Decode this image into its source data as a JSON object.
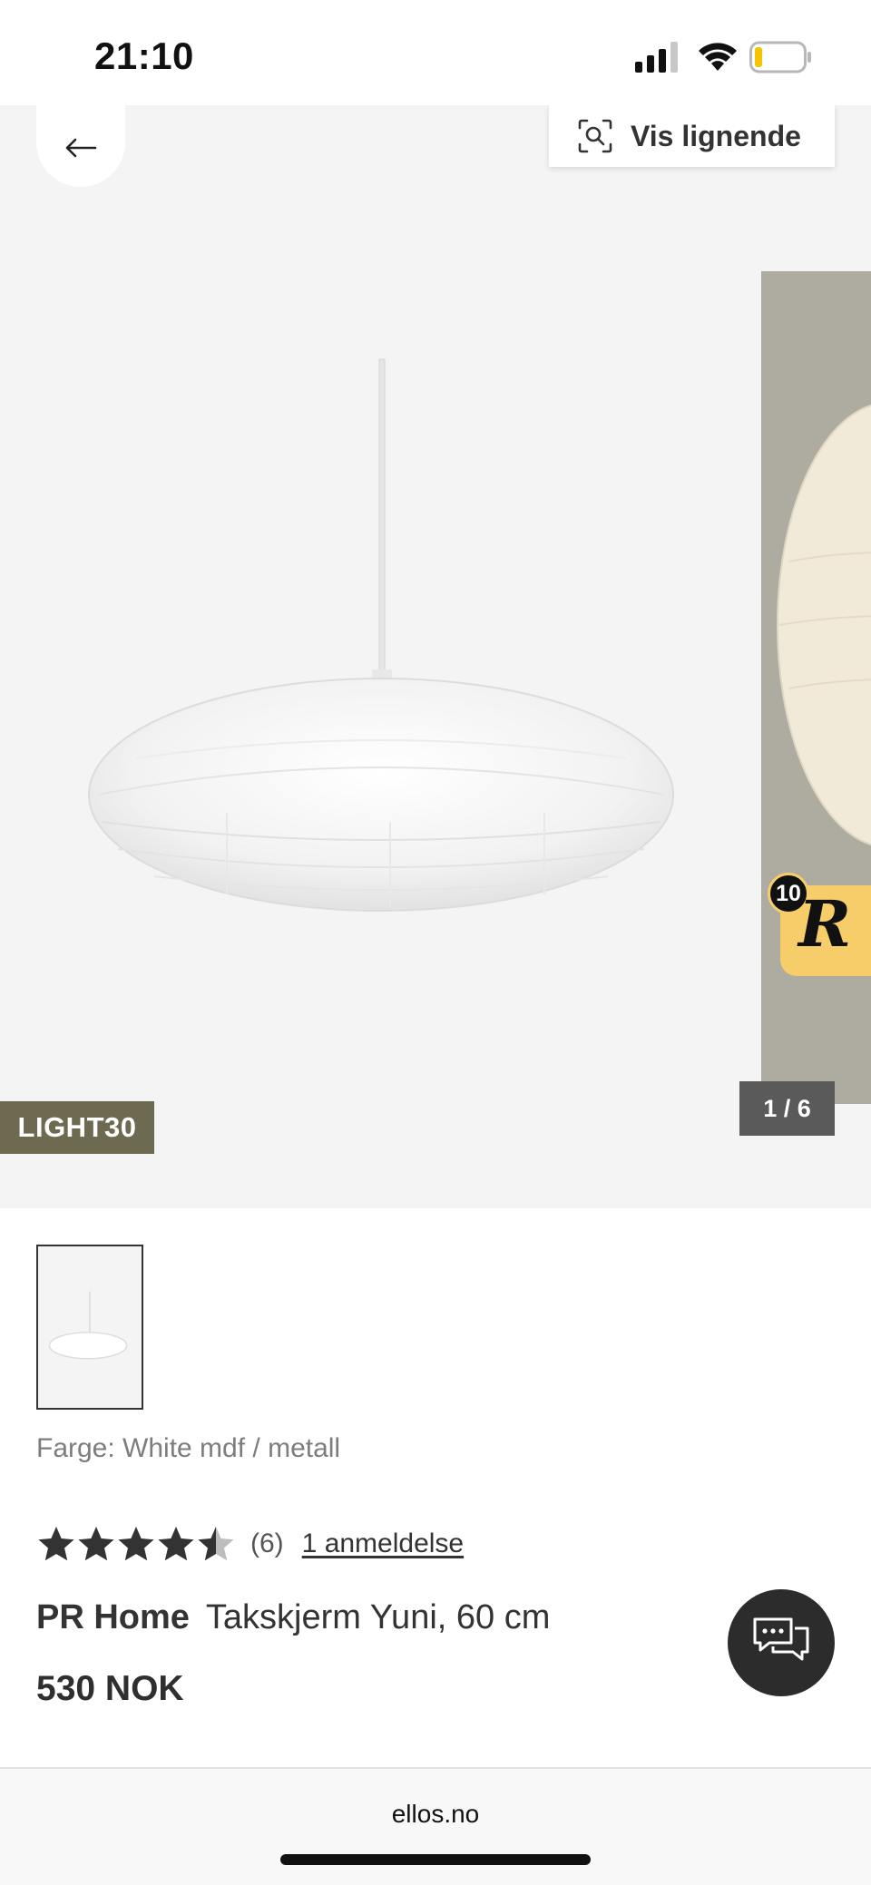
{
  "status_bar": {
    "time": "21:10",
    "icons": [
      "signal-icon",
      "wifi-icon",
      "battery-icon"
    ],
    "battery_level": 0.15,
    "battery_color": "#f5c400"
  },
  "gallery": {
    "similar_button_label": "Vis lignende",
    "promo_badge": "LIGHT30",
    "promo_badge_color": "#6d6a51",
    "page_counter": "1 / 6",
    "reviews_badge_count": "10",
    "reviews_badge_letter": "R",
    "reviews_badge_color": "#f7cd6a"
  },
  "product": {
    "color_label": "Farge: White mdf / metall",
    "rating": 4.5,
    "rating_max": 5,
    "rating_count": "(6)",
    "reviews_link": "1 anmeldelse",
    "brand": "PR Home",
    "name": "Takskjerm Yuni, 60 cm",
    "price": "530 NOK"
  },
  "browser": {
    "url": "ellos.no"
  },
  "colors": {
    "gallery_bg": "#f4f4f4",
    "chat_button_bg": "#2c2c2c",
    "counter_bg": "#5a5a5a"
  }
}
